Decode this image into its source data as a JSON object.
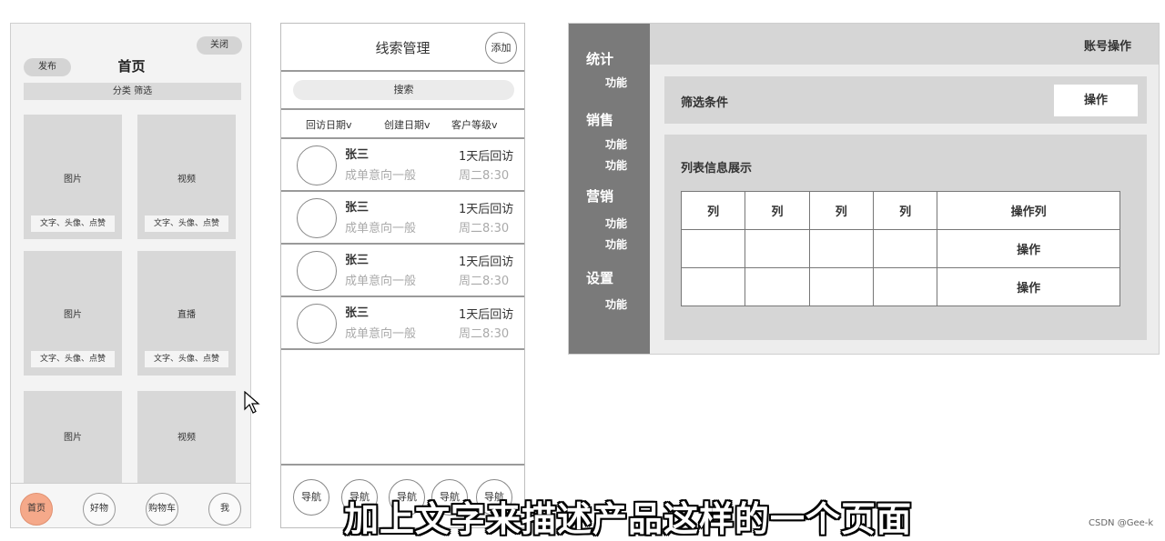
{
  "home": {
    "close_label": "关闭",
    "publish_label": "发布",
    "title": "首页",
    "filter_label": "分类 筛选",
    "cards": [
      {
        "label": "图片",
        "meta": "文字、头像、点赞"
      },
      {
        "label": "视频",
        "meta": "文字、头像、点赞"
      },
      {
        "label": "图片",
        "meta": "文字、头像、点赞"
      },
      {
        "label": "直播",
        "meta": "文字、头像、点赞"
      },
      {
        "label": "图片",
        "meta": ""
      },
      {
        "label": "视频",
        "meta": ""
      }
    ],
    "tabs": [
      {
        "label": "首页",
        "active": true
      },
      {
        "label": "好物",
        "active": false
      },
      {
        "label": "购物车",
        "active": false
      },
      {
        "label": "我",
        "active": false
      }
    ]
  },
  "leads": {
    "title": "线索管理",
    "add_label": "添加",
    "search_label": "搜索",
    "sort": [
      "回访日期v",
      "创建日期v",
      "客户等级v"
    ],
    "rows": [
      {
        "name": "张三",
        "intent": "成单意向一般",
        "follow": "1天后回访",
        "time": "周二8:30"
      },
      {
        "name": "张三",
        "intent": "成单意向一般",
        "follow": "1天后回访",
        "time": "周二8:30"
      },
      {
        "name": "张三",
        "intent": "成单意向一般",
        "follow": "1天后回访",
        "time": "周二8:30"
      },
      {
        "name": "张三",
        "intent": "成单意向一般",
        "follow": "1天后回访",
        "time": "周二8:30"
      }
    ],
    "nav": [
      "导航",
      "导航",
      "导航",
      "导航",
      "导航"
    ]
  },
  "admin": {
    "account_label": "账号操作",
    "sidebar": [
      {
        "group": "统计",
        "funcs": [
          "功能"
        ]
      },
      {
        "group": "销售",
        "funcs": [
          "功能",
          "功能"
        ]
      },
      {
        "group": "营销",
        "funcs": [
          "功能",
          "功能"
        ]
      },
      {
        "group": "设置",
        "funcs": [
          "功能"
        ]
      }
    ],
    "filter_label": "筛选条件",
    "filter_button": "操作",
    "list_title": "列表信息展示",
    "table_headers": [
      "列",
      "列",
      "列",
      "列",
      "操作列"
    ],
    "table_rows": [
      [
        "",
        "",
        "",
        "",
        "操作"
      ],
      [
        "",
        "",
        "",
        "",
        "操作"
      ]
    ]
  },
  "subtitle": "加上文字来描述产品这样的一个页面",
  "watermark": "CSDN @Gee-k"
}
